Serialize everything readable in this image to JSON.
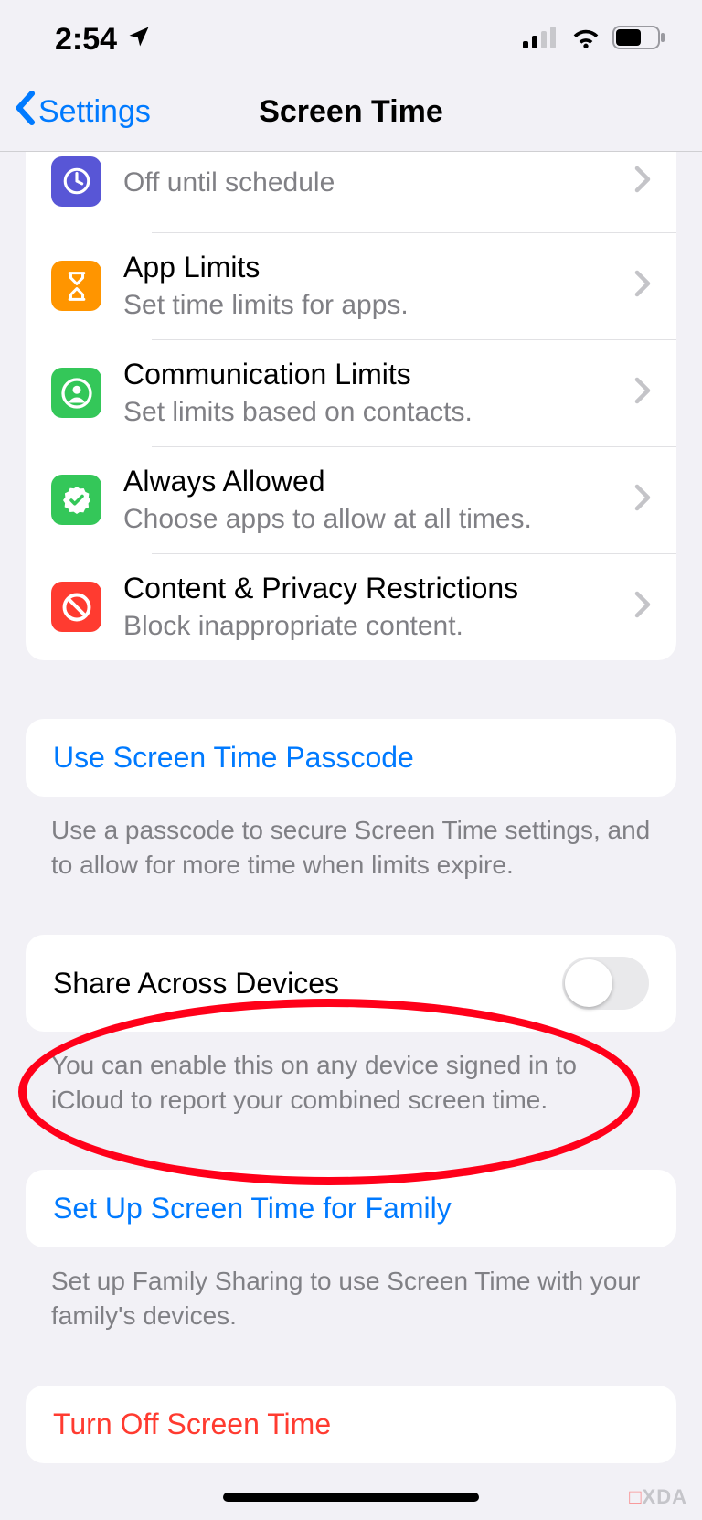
{
  "status": {
    "time": "2:54",
    "location_icon": "location-arrow",
    "signal_bars": 2,
    "wifi": true,
    "battery_pct": 55
  },
  "nav": {
    "back_label": "Settings",
    "title": "Screen Time"
  },
  "limits_group": {
    "downtime": {
      "subtitle": "Off until schedule"
    },
    "app_limits": {
      "title": "App Limits",
      "subtitle": "Set time limits for apps."
    },
    "comm_limits": {
      "title": "Communication Limits",
      "subtitle": "Set limits based on contacts."
    },
    "always_allowed": {
      "title": "Always Allowed",
      "subtitle": "Choose apps to allow at all times."
    },
    "restrictions": {
      "title": "Content & Privacy Restrictions",
      "subtitle": "Block inappropriate content."
    }
  },
  "passcode": {
    "button": "Use Screen Time Passcode",
    "footer": "Use a passcode to secure Screen Time settings, and to allow for more time when limits expire."
  },
  "share": {
    "title": "Share Across Devices",
    "enabled": false,
    "footer": "You can enable this on any device signed in to iCloud to report your combined screen time."
  },
  "family": {
    "button": "Set Up Screen Time for Family",
    "footer": "Set up Family Sharing to use Screen Time with your family's devices.",
    "highlighted": true
  },
  "turn_off": {
    "button": "Turn Off Screen Time"
  },
  "watermark": "XDA"
}
